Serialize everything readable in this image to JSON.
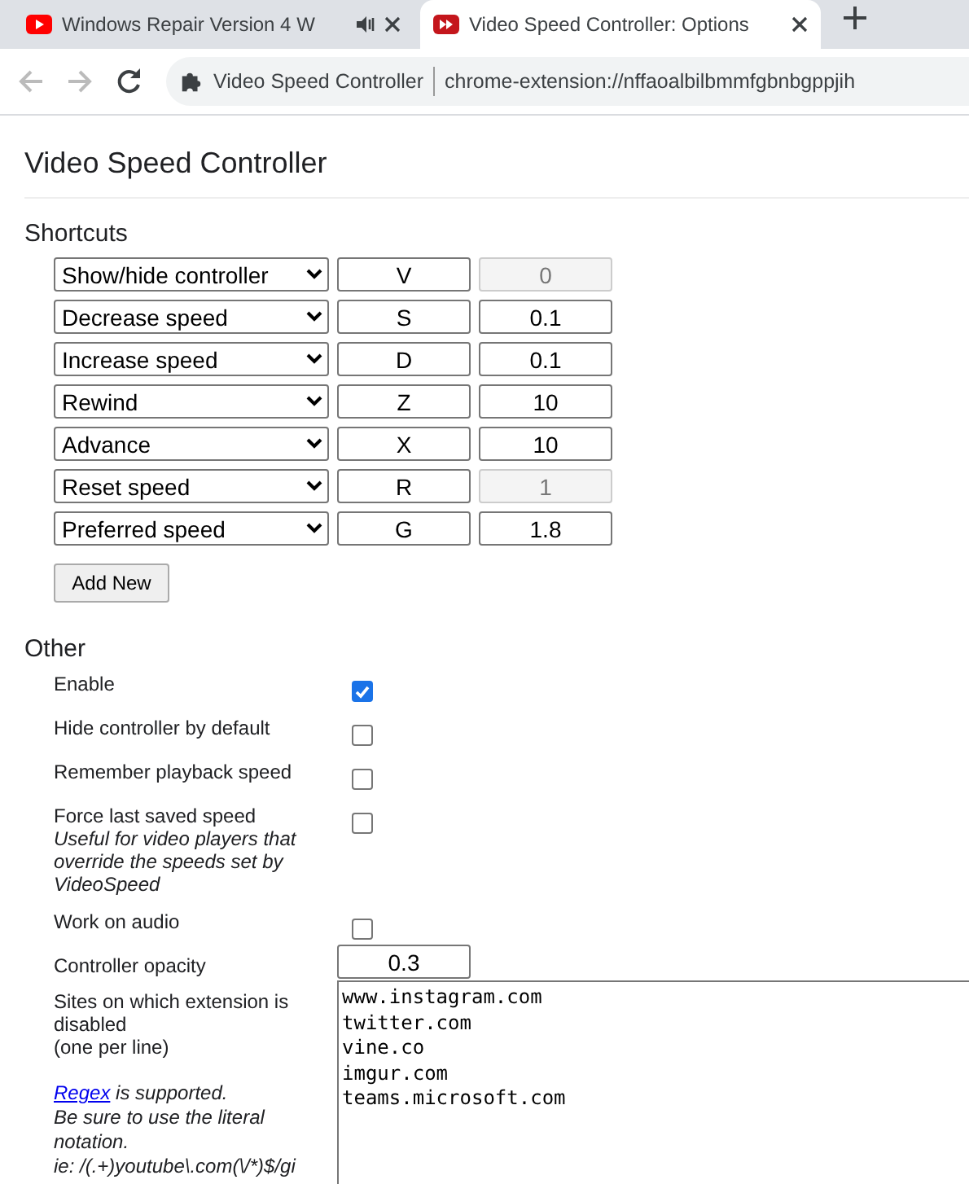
{
  "browser": {
    "tabs": [
      {
        "title": "Windows Repair Version 4 W",
        "audio": true,
        "selected": false
      },
      {
        "title": "Video Speed Controller: Options",
        "audio": false,
        "selected": true
      }
    ],
    "address": {
      "site": "Video Speed Controller",
      "url": "chrome-extension://nffaoalbilbmmfgbnbgppjih"
    }
  },
  "title": "Video Speed Controller",
  "shortcuts": {
    "heading": "Shortcuts",
    "rows": [
      {
        "action": "Show/hide controller",
        "key": "V",
        "value": "0",
        "disabled": true
      },
      {
        "action": "Decrease speed",
        "key": "S",
        "value": "0.1",
        "disabled": false
      },
      {
        "action": "Increase speed",
        "key": "D",
        "value": "0.1",
        "disabled": false
      },
      {
        "action": "Rewind",
        "key": "Z",
        "value": "10",
        "disabled": false
      },
      {
        "action": "Advance",
        "key": "X",
        "value": "10",
        "disabled": false
      },
      {
        "action": "Reset speed",
        "key": "R",
        "value": "1",
        "disabled": true
      },
      {
        "action": "Preferred speed",
        "key": "G",
        "value": "1.8",
        "disabled": false
      }
    ],
    "add_button": "Add New"
  },
  "other": {
    "heading": "Other",
    "options": [
      {
        "kind": "checkbox",
        "label": "Enable",
        "checked": true
      },
      {
        "kind": "checkbox",
        "label": "Hide controller by default",
        "checked": false
      },
      {
        "kind": "checkbox",
        "label": "Remember playback speed",
        "checked": false
      },
      {
        "kind": "checkbox",
        "label": "Force last saved speed",
        "note": "Useful for video players that override the speeds set by VideoSpeed",
        "checked": false
      },
      {
        "kind": "checkbox",
        "label": "Work on audio",
        "checked": false
      },
      {
        "kind": "number",
        "label": "Controller opacity",
        "value": "0.3"
      }
    ],
    "blacklist": {
      "label": "Sites on which extension is disabled",
      "hint": "(one per line)",
      "link": "Regex",
      "link_suffix": " is supported.",
      "notes": [
        "Be sure to use the literal notation.",
        "ie: /(.+)youtube\\.com(\\/*)$/gi"
      ],
      "value": [
        "www.instagram.com",
        "twitter.com",
        "vine.co",
        "imgur.com",
        "teams.microsoft.com"
      ]
    }
  }
}
